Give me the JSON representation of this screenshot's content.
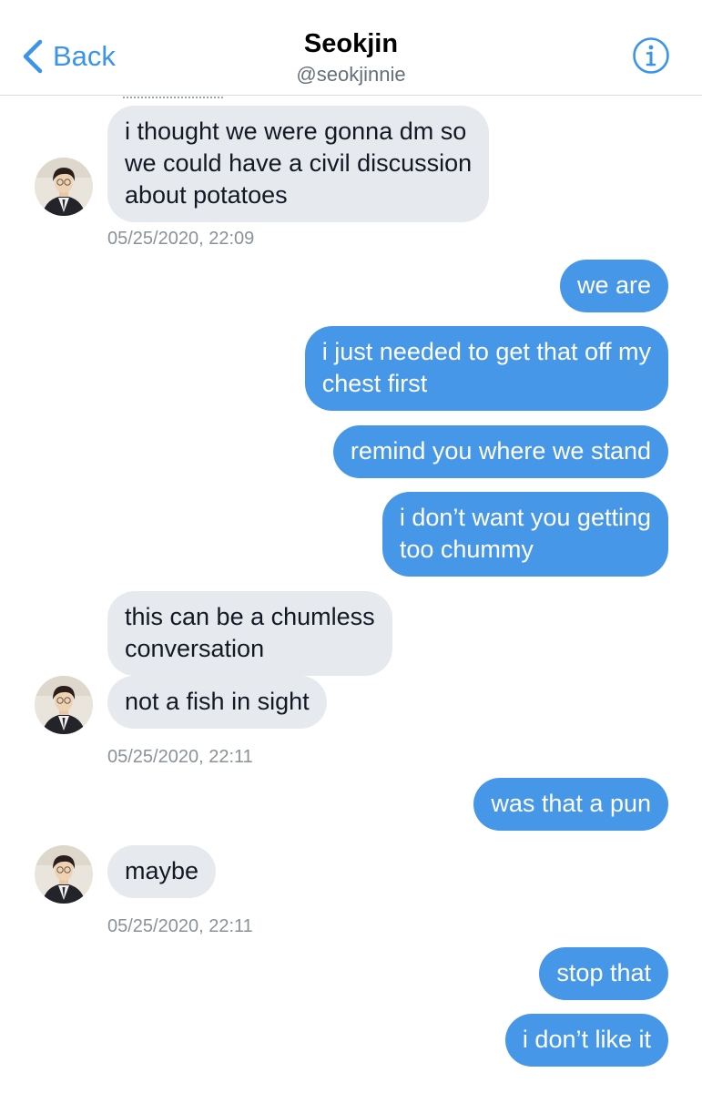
{
  "header": {
    "back_label": "Back",
    "title": "Seokjin",
    "handle": "@seokjinnie"
  },
  "colors": {
    "accent": "#3b94e8",
    "outgoing_bubble": "#4797e9",
    "incoming_bubble": "#e6e9ee",
    "timestamp": "#8a9299"
  },
  "icons": {
    "back": "chevron-left-icon",
    "info": "info-circle-icon"
  },
  "messages": [
    {
      "dir": "in",
      "lines": [
        "i thought we were gonna dm so",
        "we could have a civil discussion",
        "about potatoes"
      ]
    },
    {
      "dir": "out",
      "lines": [
        "we are"
      ]
    },
    {
      "dir": "out",
      "lines": [
        "i just needed to get that off my",
        "chest first"
      ]
    },
    {
      "dir": "out",
      "lines": [
        "remind you where we stand"
      ]
    },
    {
      "dir": "out",
      "lines": [
        "i don’t want you getting",
        "too chummy"
      ]
    },
    {
      "dir": "in",
      "lines": [
        "this can be a chumless",
        "conversation"
      ]
    },
    {
      "dir": "in",
      "lines": [
        "not a fish in sight"
      ]
    },
    {
      "dir": "out",
      "lines": [
        "was that a pun"
      ]
    },
    {
      "dir": "in",
      "lines": [
        "maybe"
      ]
    },
    {
      "dir": "out",
      "lines": [
        "stop that"
      ]
    },
    {
      "dir": "out",
      "lines": [
        "i don’t like it"
      ]
    }
  ],
  "timestamps": [
    "05/25/2020, 22:09",
    "05/25/2020, 22:11",
    "05/25/2020, 22:11"
  ]
}
